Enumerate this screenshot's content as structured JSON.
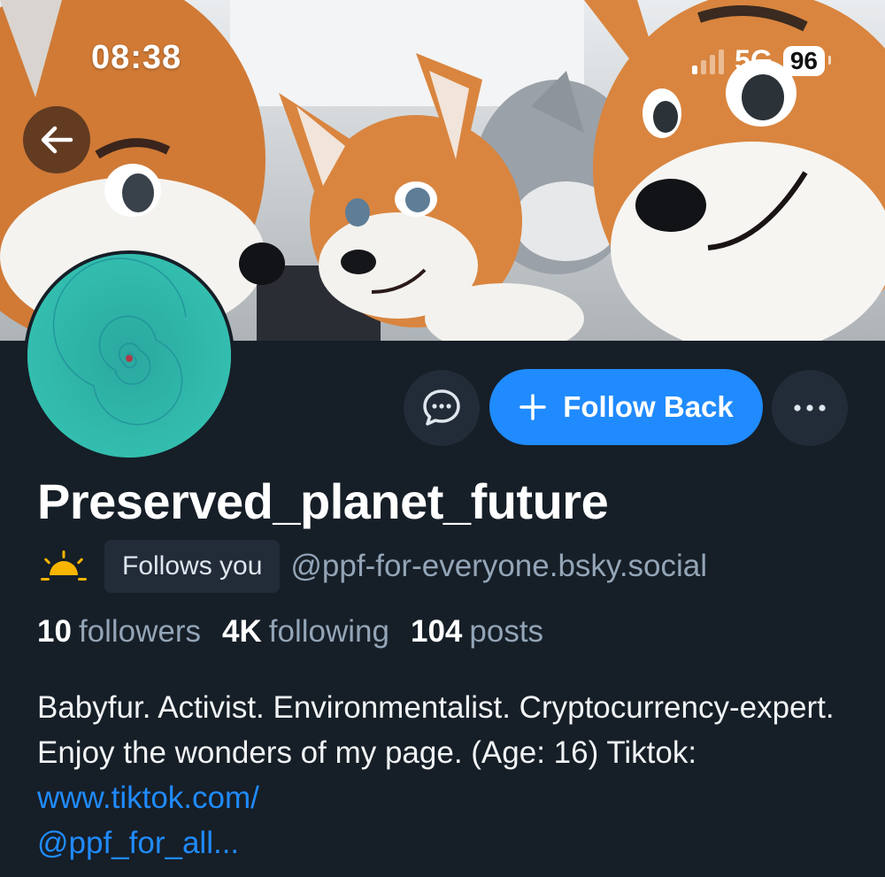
{
  "status_bar": {
    "time": "08:38",
    "network": "5G",
    "battery": "96"
  },
  "profile": {
    "display_name": "Preserved_planet_future",
    "emoji": "sunrise-icon",
    "follows_you_label": "Follows you",
    "handle": "@ppf-for-everyone.bsky.social",
    "stats": {
      "followers_count": "10",
      "followers_label": "followers",
      "following_count": "4K",
      "following_label": "following",
      "posts_count": "104",
      "posts_label": "posts"
    },
    "bio": {
      "text": "Babyfur. Activist. Environmentalist. Cryptocurrency-expert. Enjoy the wonders of my page. (Age: 16) Tiktok: ",
      "link_line1": "www.tiktok.com/",
      "link_line2": "@ppf_for_all..."
    }
  },
  "actions": {
    "follow_back_label": "Follow Back"
  },
  "colors": {
    "background": "#161e27",
    "accent": "#208bfe",
    "muted_text": "#93a5b7",
    "button_bg": "#222c38"
  }
}
